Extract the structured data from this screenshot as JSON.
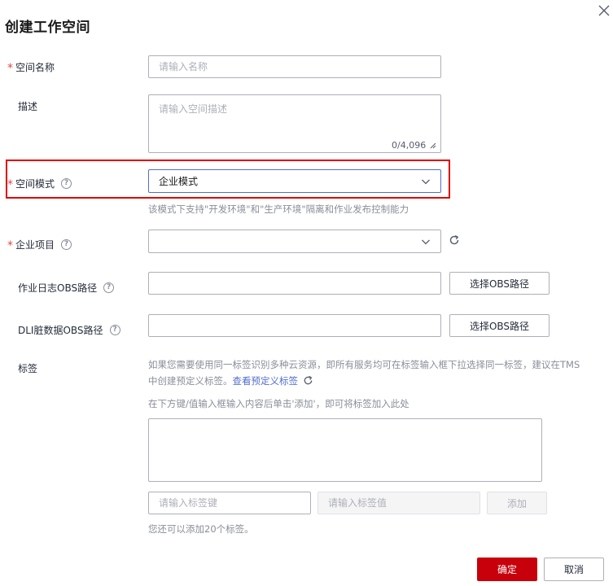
{
  "dialog": {
    "title": "创建工作空间",
    "close_icon": "close-icon"
  },
  "form": {
    "space_name": {
      "label": "空间名称",
      "required": "*",
      "placeholder": "请输入名称"
    },
    "description": {
      "label": "描述",
      "placeholder": "请输入空间描述",
      "counter": "0/4,096"
    },
    "space_mode": {
      "label": "空间模式",
      "required": "*",
      "help": "?",
      "selected": "企业模式",
      "hint": "该模式下支持\"开发环境\"和\"生产环境\"隔离和作业发布控制能力"
    },
    "enterprise_project": {
      "label": "企业项目",
      "required": "*",
      "help": "?",
      "selected": ""
    },
    "job_log_obs": {
      "label": "作业日志OBS路径",
      "help": "?",
      "value": "",
      "button": "选择OBS路径"
    },
    "dli_dirty_obs": {
      "label": "DLI脏数据OBS路径",
      "help": "?",
      "value": "",
      "button": "选择OBS路径"
    },
    "tags": {
      "label": "标签",
      "description_line1": "如果您需要使用同一标签识别多种云资源，即所有服务均可在标签输入框下拉选择同一标签，建议在TMS",
      "description_line2": "中创建预定义标签。",
      "link": "查看预定义标签",
      "instruction": "在下方键/值输入框输入内容后单击'添加'，即可将标签加入此处",
      "key_placeholder": "请输入标签键",
      "value_placeholder": "请输入标签值",
      "add_button": "添加",
      "remaining": "您还可以添加20个标签。"
    }
  },
  "footer": {
    "confirm": "确定",
    "cancel": "取消"
  },
  "colors": {
    "primary": "#c7000b",
    "required": "#e54545",
    "link": "#526ecc",
    "highlight": "#e00000"
  }
}
